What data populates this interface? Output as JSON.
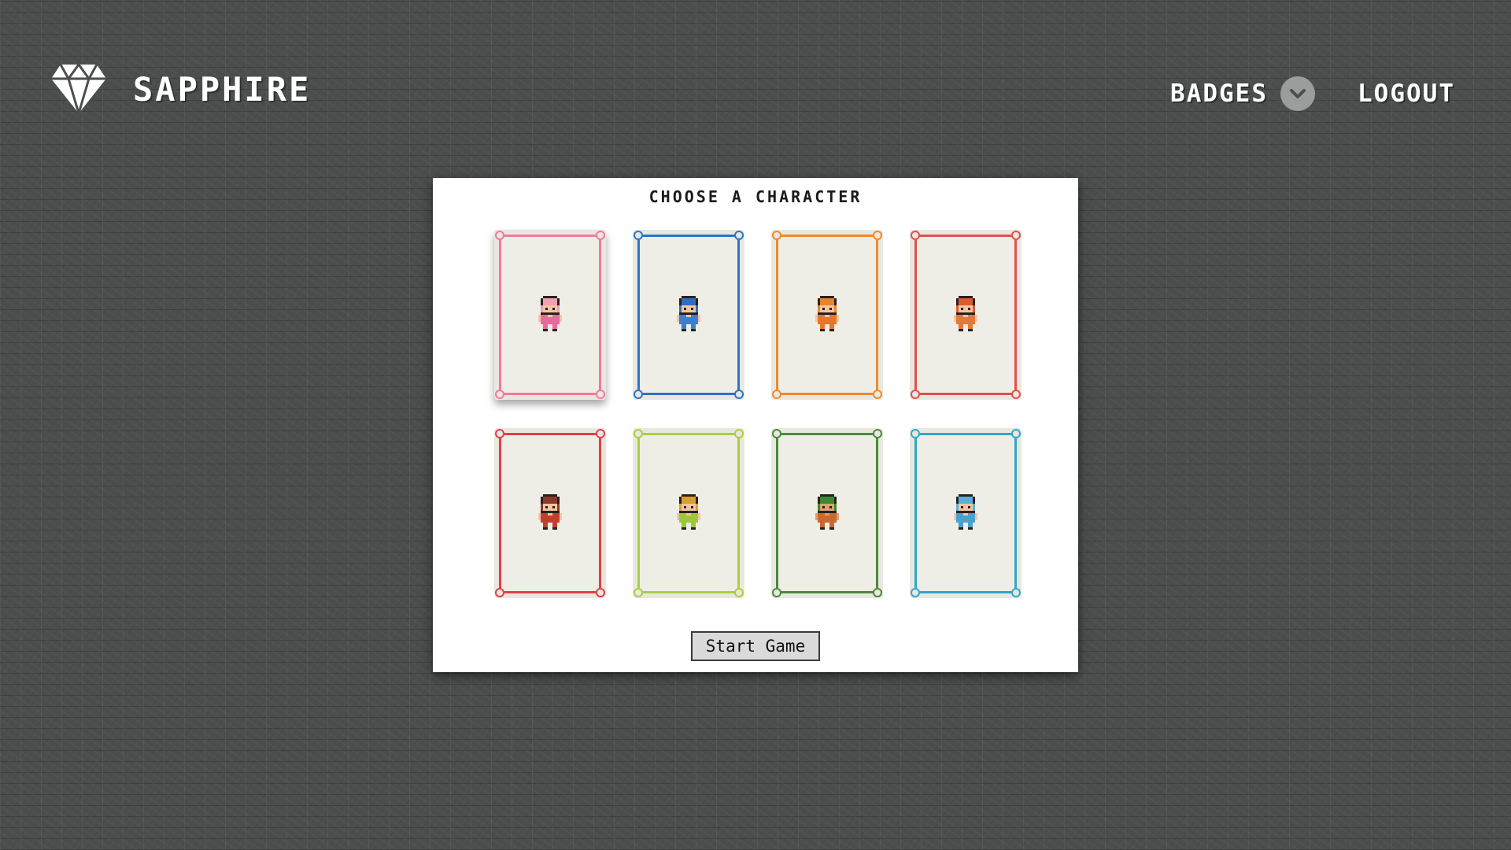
{
  "header": {
    "brand": "SAPPHIRE",
    "logo_icon": "diamond-icon",
    "nav": {
      "badges_label": "BADGES",
      "badges_icon": "chevron-down-icon",
      "logout_label": "LOGOUT"
    }
  },
  "panel": {
    "title": "CHOOSE A CHARACTER",
    "start_button": "Start Game"
  },
  "characters": [
    {
      "frame_color": "#f07aa0",
      "hair": "#f2a0b4",
      "outfit": "#e86a9a",
      "skin": "#f3c6a2",
      "selected": true
    },
    {
      "frame_color": "#2b74c8",
      "hair": "#2e6fc4",
      "outfit": "#3a7fd0",
      "skin": "#f3c6a2",
      "selected": false
    },
    {
      "frame_color": "#f08a2c",
      "hair": "#e8852a",
      "outfit": "#e8762a",
      "skin": "#f3c6a2",
      "selected": false
    },
    {
      "frame_color": "#e0504c",
      "hair": "#e05a30",
      "outfit": "#e07a3a",
      "skin": "#f3c6a2",
      "selected": false
    },
    {
      "frame_color": "#e0404a",
      "hair": "#8a3a2a",
      "outfit": "#c0402e",
      "skin": "#f3c6a2",
      "selected": false
    },
    {
      "frame_color": "#a8d040",
      "hair": "#d8a030",
      "outfit": "#9cc83a",
      "skin": "#f3c6a2",
      "selected": false
    },
    {
      "frame_color": "#4a8a3a",
      "hair": "#3a8a30",
      "outfit": "#c86a30",
      "skin": "#e0a070",
      "selected": false
    },
    {
      "frame_color": "#30a8c8",
      "hair": "#5ab0d8",
      "outfit": "#4aa0d0",
      "skin": "#f3c6a2",
      "selected": false
    }
  ]
}
